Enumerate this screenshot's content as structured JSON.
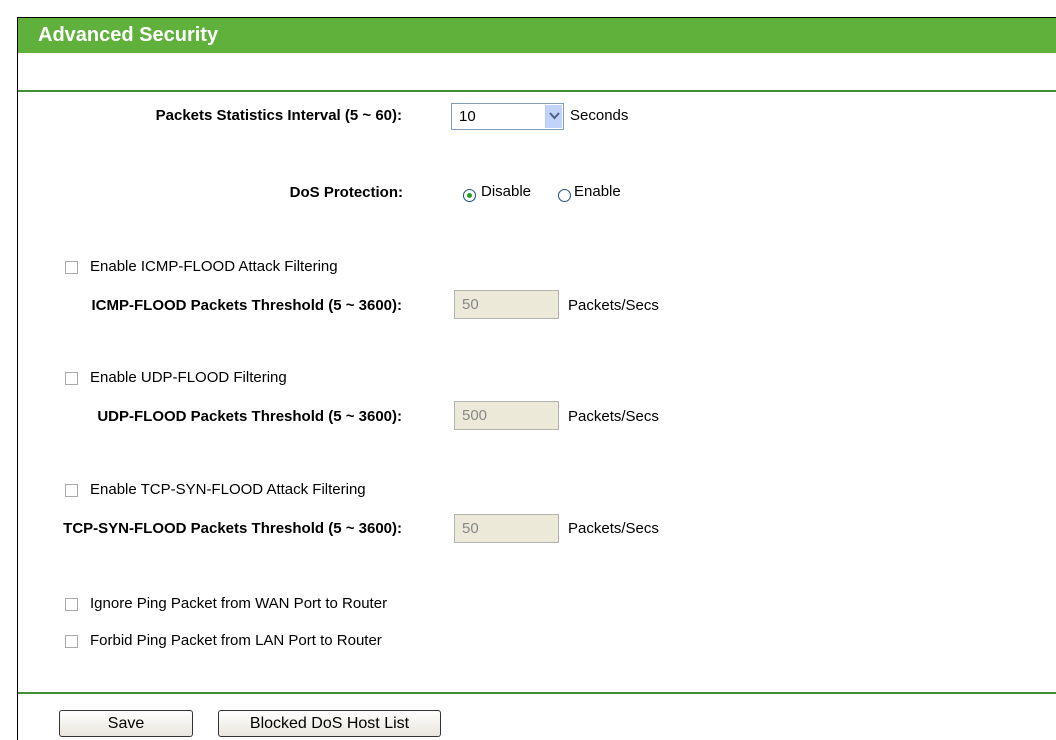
{
  "header": {
    "title": "Advanced Security"
  },
  "interval": {
    "label": "Packets Statistics Interval (5 ~ 60):",
    "value": "10",
    "unit": "Seconds"
  },
  "dos": {
    "label": "DoS Protection:",
    "options": [
      "Disable",
      "Enable"
    ],
    "selected": "Disable"
  },
  "icmp": {
    "checkbox_label": "Enable ICMP-FLOOD Attack Filtering",
    "checked": false,
    "threshold_label": "ICMP-FLOOD Packets Threshold (5 ~ 3600):",
    "threshold_value": "50",
    "unit": "Packets/Secs"
  },
  "udp": {
    "checkbox_label": "Enable UDP-FLOOD Filtering",
    "checked": false,
    "threshold_label": "UDP-FLOOD Packets Threshold (5 ~ 3600):",
    "threshold_value": "500",
    "unit": "Packets/Secs"
  },
  "tcp": {
    "checkbox_label": "Enable TCP-SYN-FLOOD Attack Filtering",
    "checked": false,
    "threshold_label": "TCP-SYN-FLOOD Packets Threshold (5 ~ 3600):",
    "threshold_value": "50",
    "unit": "Packets/Secs"
  },
  "ping": {
    "wan_label": "Ignore Ping Packet from WAN Port to Router",
    "lan_label": "Forbid Ping Packet from LAN Port to Router"
  },
  "buttons": {
    "save": "Save",
    "blocked_list": "Blocked DoS Host List"
  },
  "colors": {
    "header": "#5fb13c",
    "divider": "#3f8f34",
    "disabled_input": "#ece9d8"
  }
}
